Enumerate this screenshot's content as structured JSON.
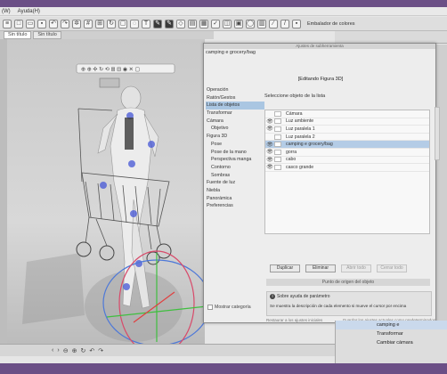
{
  "menubar": {
    "items": [
      "(W)",
      "Ayuda(H)"
    ]
  },
  "toolbar": {
    "right_label": "Embalador de colores"
  },
  "tabs": [
    {
      "label": "Sin título"
    },
    {
      "label": "Sin título"
    }
  ],
  "dialog": {
    "top_title": "Ajustes de subherramienta",
    "file_title": "camping e grocery/bag",
    "editing_title": "[Editando Figura 3D]",
    "nav_items": [
      {
        "label": "Operación",
        "indent": false,
        "selected": false
      },
      {
        "label": "Ratón/Gestos",
        "indent": false,
        "selected": false
      },
      {
        "label": "Lista de objetos",
        "indent": false,
        "selected": true
      },
      {
        "label": "Transformar",
        "indent": false,
        "selected": false
      },
      {
        "label": "Cámara",
        "indent": false,
        "selected": false
      },
      {
        "label": "Objetivo",
        "indent": true,
        "selected": false
      },
      {
        "label": "Figura 3D",
        "indent": false,
        "selected": false
      },
      {
        "label": "Pose",
        "indent": true,
        "selected": false
      },
      {
        "label": "Pose de la mano",
        "indent": true,
        "selected": false
      },
      {
        "label": "Perspectiva manga",
        "indent": true,
        "selected": false
      },
      {
        "label": "Contorno",
        "indent": true,
        "selected": false
      },
      {
        "label": "Sombras",
        "indent": true,
        "selected": false
      },
      {
        "label": "Fuente de luz",
        "indent": false,
        "selected": false
      },
      {
        "label": "Niebla",
        "indent": false,
        "selected": false
      },
      {
        "label": "Panorámica",
        "indent": false,
        "selected": false
      },
      {
        "label": "Preferencias",
        "indent": false,
        "selected": false
      }
    ],
    "content_title": "Seleccione objeto de la lista",
    "objects": [
      {
        "name": "Cámara",
        "eye": false,
        "selected": false
      },
      {
        "name": "Luz ambiente",
        "eye": true,
        "selected": false
      },
      {
        "name": "Luz paralela 1",
        "eye": true,
        "selected": false
      },
      {
        "name": "Luz paralela 2",
        "eye": false,
        "selected": false
      },
      {
        "name": "camping e grocery/bag",
        "eye": true,
        "selected": true
      },
      {
        "name": "gorra",
        "eye": true,
        "selected": false
      },
      {
        "name": "cabo",
        "eye": true,
        "selected": false
      },
      {
        "name": "casco grande",
        "eye": true,
        "selected": false
      }
    ],
    "buttons": [
      "Duplicar",
      "Eliminar",
      "Abrir todo",
      "Cerrar todo"
    ],
    "param_row": "Punto de origen del objeto",
    "help": {
      "title": "Sobre ayuda de parámetro",
      "text": "Se muestra la descripción de cada elemento si mueve el cursor por encima"
    },
    "show_category": "Mostrar categoría",
    "footer_left": "Restaurar a los ajustes iniciales",
    "footer_right": "Guardar los ajustes actuales como predeterminados"
  },
  "layers": [
    {
      "label": "camping e",
      "selected": true
    },
    {
      "label": "Transformar",
      "selected": false
    },
    {
      "label": "Cambiar cámara",
      "selected": false
    }
  ],
  "bottombar": {
    "icons": [
      "<",
      ">",
      "zoom-out",
      "zoom-in",
      "rotate",
      "undo",
      "redo"
    ]
  }
}
